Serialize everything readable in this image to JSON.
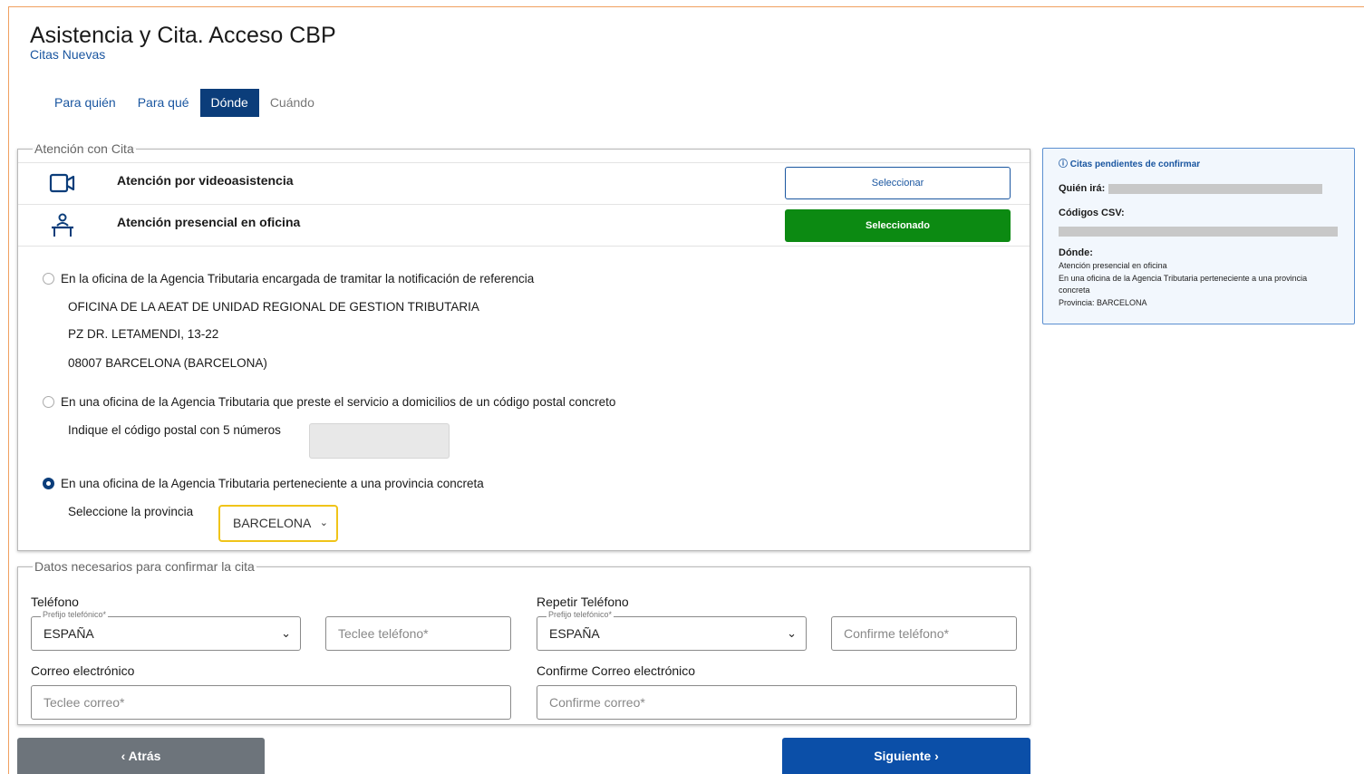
{
  "header": {
    "title": "Asistencia y Cita. Acceso CBP",
    "subtitle": "Citas Nuevas"
  },
  "steps": [
    {
      "label": "Para quién",
      "state": "link"
    },
    {
      "label": "Para qué",
      "state": "link"
    },
    {
      "label": "Dónde",
      "state": "active"
    },
    {
      "label": "Cuándo",
      "state": "disabled"
    }
  ],
  "attention": {
    "legend": "Atención con Cita",
    "video": {
      "label": "Atención por videoasistencia",
      "button": "Seleccionar",
      "icon": "video-camera-icon"
    },
    "office": {
      "label": "Atención presencial en oficina",
      "button": "Seleccionado",
      "icon": "person-desk-icon"
    },
    "option1": {
      "label": "En la oficina de la Agencia Tributaria encargada de tramitar la notificación de referencia",
      "address_line1": "OFICINA DE LA AEAT DE UNIDAD REGIONAL DE GESTION TRIBUTARIA",
      "address_line2": "PZ DR. LETAMENDI, 13-22",
      "address_line3": "08007 BARCELONA (BARCELONA)"
    },
    "option2": {
      "label": "En una oficina de la Agencia Tributaria que preste el servicio a domicilios de un código postal concreto",
      "postal_label": "Indique el código postal con 5 números",
      "postal_value": ""
    },
    "option3": {
      "label": "En una oficina de la Agencia Tributaria perteneciente a una provincia concreta",
      "province_label": "Seleccione la provincia",
      "province_value": "BARCELONA"
    },
    "selected_option": 3
  },
  "summary": {
    "header": "Citas pendientes de confirmar",
    "who_label": "Quién irá:",
    "csv_label": "Códigos CSV:",
    "where_label": "Dónde:",
    "where_line1": "Atención presencial en oficina",
    "where_line2": "En una oficina de la Agencia Tributaria perteneciente a una provincia concreta",
    "where_line3": "Provincia: BARCELONA"
  },
  "contact": {
    "legend": "Datos necesarios para confirmar la cita",
    "phone_title": "Teléfono",
    "phone_prefix_label": "Prefijo telefónico*",
    "phone_prefix_value": "ESPAÑA",
    "phone_placeholder": "Teclee teléfono*",
    "phone2_title": "Repetir Teléfono",
    "phone2_prefix_label": "Prefijo telefónico*",
    "phone2_prefix_value": "ESPAÑA",
    "phone2_placeholder": "Confirme teléfono*",
    "email_title": "Correo electrónico",
    "email_placeholder": "Teclee correo*",
    "email2_title": "Confirme Correo electrónico",
    "email2_placeholder": "Confirme correo*"
  },
  "nav": {
    "back": "Atrás",
    "next": "Siguiente"
  },
  "colors": {
    "primary": "#0b3d7a",
    "link": "#1a56a0",
    "selected_green": "#0c8a12",
    "focus_yellow": "#f0c419",
    "back_gray": "#6d747b"
  }
}
